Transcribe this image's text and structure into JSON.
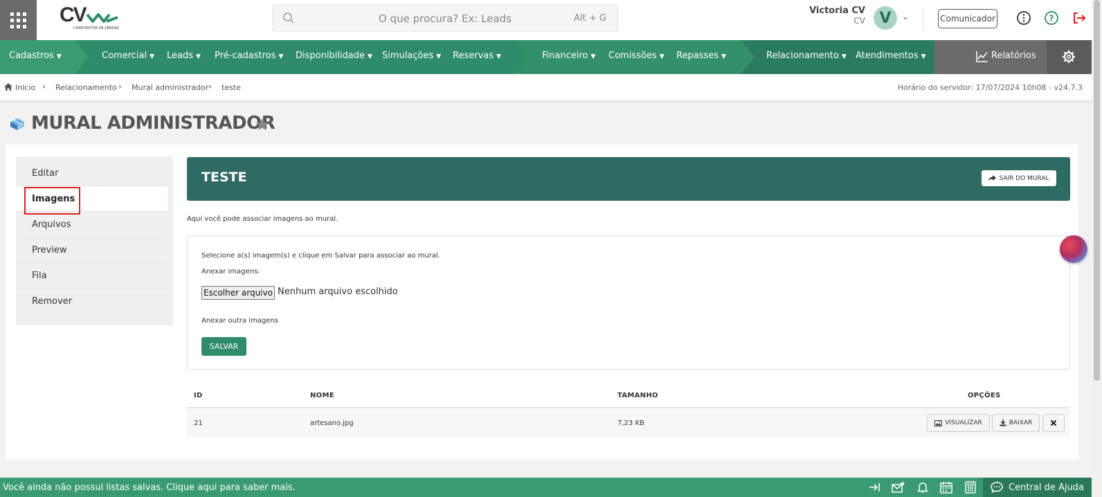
{
  "header": {
    "search_placeholder": "O que procura? Ex: Leads",
    "search_shortcut": "Alt + G",
    "logo_text": "CV",
    "logo_sub": "CONSTRUTOR DE VENDAS",
    "user_name": "Victoria CV",
    "user_sub": "CV",
    "avatar_letter": "V",
    "comunicador": "Comunicador"
  },
  "nav": {
    "items": [
      {
        "label": "Cadastros"
      },
      {
        "label": "Comercial"
      },
      {
        "label": "Leads"
      },
      {
        "label": "Pré-cadastros"
      },
      {
        "label": "Disponibilidade"
      },
      {
        "label": "Simulações"
      },
      {
        "label": "Reservas"
      },
      {
        "label": "Financeiro"
      },
      {
        "label": "Comissões"
      },
      {
        "label": "Repasses"
      },
      {
        "label": "Relacionamento"
      },
      {
        "label": "Atendimentos"
      }
    ],
    "relatorios": "Relatórios"
  },
  "breadcrumb": {
    "items": [
      "Início",
      "Relacionamento",
      "Mural administrador",
      "teste"
    ],
    "server_time": "Horário do servidor: 17/07/2024 10h08 - v24.7.3"
  },
  "page": {
    "title": "MURAL ADMINISTRADOR"
  },
  "sidebar": {
    "items": [
      {
        "label": "Editar"
      },
      {
        "label": "Imagens"
      },
      {
        "label": "Arquivos"
      },
      {
        "label": "Preview"
      },
      {
        "label": "Fila"
      },
      {
        "label": "Remover"
      }
    ]
  },
  "mural": {
    "title": "TESTE",
    "exit_button": "SAIR DO MURAL",
    "help_text": "Aqui você pode associar imagens ao mural.",
    "instructions": "Selecione a(s) imagem(s) e clique em Salvar para associar ao mural.",
    "attach_label": "Anexar imagens:",
    "file_button": "Escolher arquivo",
    "no_file": "Nenhum arquivo escolhido",
    "attach_another": "Anexar outra imagens",
    "save_button": "SALVAR"
  },
  "table": {
    "headers": {
      "id": "ID",
      "nome": "NOME",
      "tamanho": "TAMANHO",
      "opcoes": "OPÇÕES"
    },
    "rows": [
      {
        "id": "21",
        "nome": "artesano.jpg",
        "tamanho": "7,23 KB"
      }
    ],
    "view_button": "VISUALIZAR",
    "download_button": "BAIXAR"
  },
  "footer": {
    "text": "Você ainda não possui listas salvas. Clique aqui para saber mais.",
    "help_center": "Central de Ajuda"
  },
  "colors": {
    "nav_green": "#2f8c68",
    "banner": "#2e6b62",
    "footer": "#3a9b72",
    "highlight_red": "#e02020"
  }
}
